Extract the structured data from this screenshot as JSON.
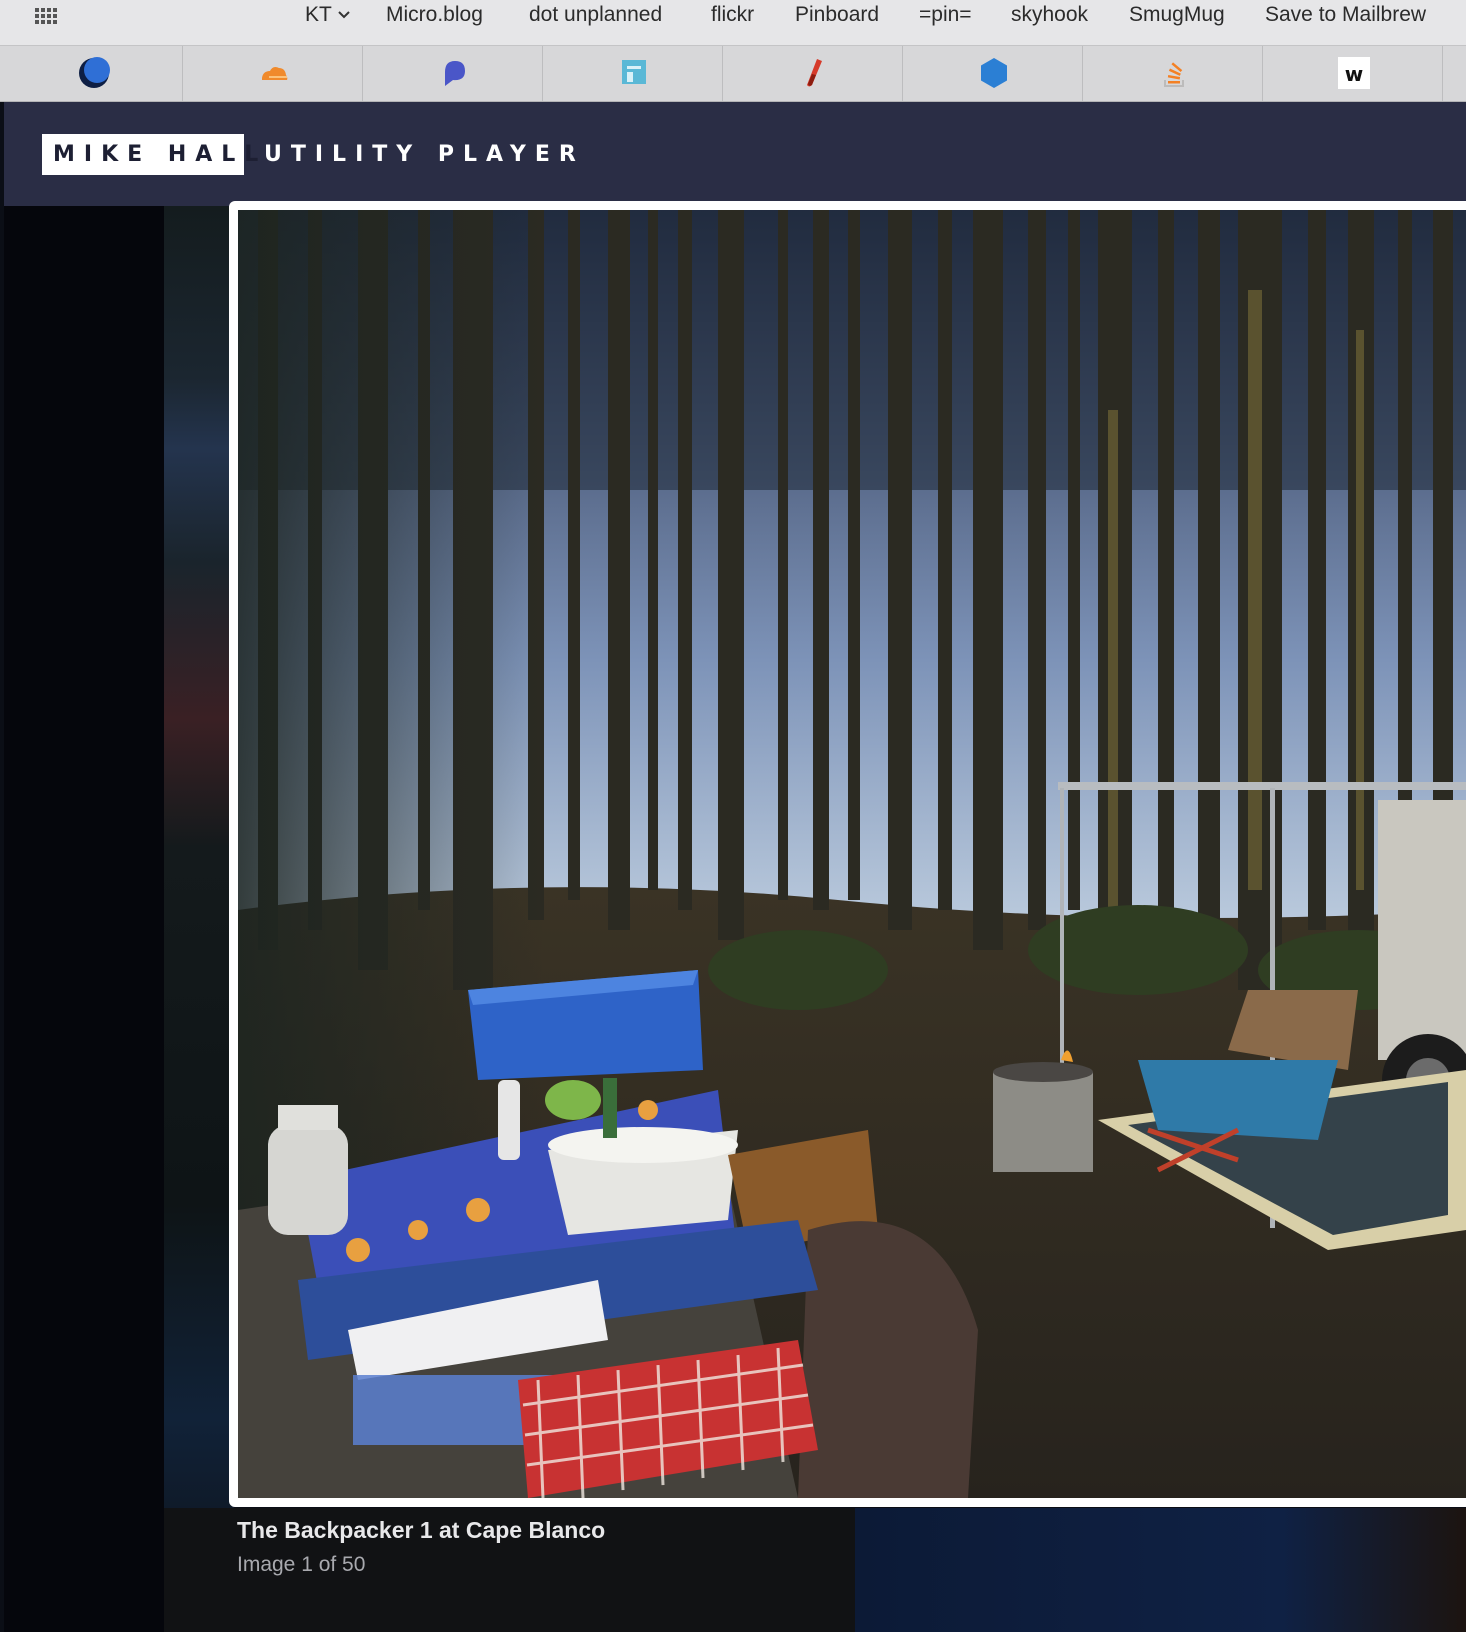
{
  "bookmarks_bar": {
    "apps_icon": "apps-grid-icon",
    "folder": {
      "label": "KT",
      "icon": "chevron-down-icon"
    },
    "items": [
      {
        "label": "Micro.blog"
      },
      {
        "label": "dot unplanned"
      },
      {
        "label": "flickr"
      },
      {
        "label": "Pinboard"
      },
      {
        "label": "=pin="
      },
      {
        "label": "skyhook"
      },
      {
        "label": "SmugMug"
      },
      {
        "label": "Save to Mailbrew"
      }
    ]
  },
  "tabs": [
    {
      "icon": "crescent-moon-icon",
      "color": "#1e4fa8"
    },
    {
      "icon": "cloud-icon",
      "color": "#f08a2c"
    },
    {
      "icon": "speech-bubble-icon",
      "color": "#4a56c8"
    },
    {
      "icon": "notepad-icon",
      "color": "#5ab8d6"
    },
    {
      "icon": "test-tube-icon",
      "color": "#d63a2a"
    },
    {
      "icon": "hexagon-icon",
      "color": "#2b7fd4"
    },
    {
      "icon": "stack-overflow-icon",
      "color": "#f48024"
    },
    {
      "icon": "w-logo-icon",
      "label": "w",
      "color": "#111111"
    }
  ],
  "site": {
    "name": "MIKE HALL",
    "tagline": "UTILITY PLAYER",
    "header_color": "#2a2d45"
  },
  "lightbox": {
    "photo_description_icon": "campsite-photo",
    "caption": "The Backpacker 1 at Cape Blanco",
    "counter": "Image 1 of 50"
  }
}
